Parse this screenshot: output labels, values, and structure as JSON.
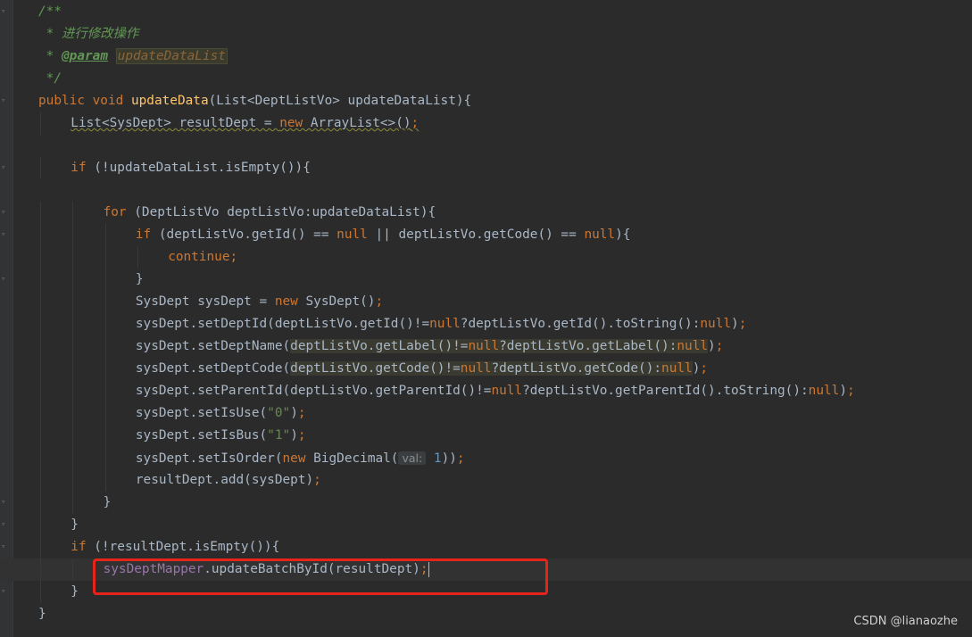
{
  "lines": [
    {
      "indent": 0,
      "tokens": [
        {
          "c": "doc",
          "t": "/**"
        }
      ]
    },
    {
      "indent": 0,
      "tokens": [
        {
          "c": "doc",
          "t": " * 进行修改操作"
        }
      ]
    },
    {
      "indent": 0,
      "tokens": [
        {
          "c": "doc",
          "t": " * "
        },
        {
          "c": "doctag",
          "t": "@param"
        },
        {
          "c": "doc",
          "t": " "
        },
        {
          "c": "docparam",
          "t": "updateDataList"
        }
      ]
    },
    {
      "indent": 0,
      "tokens": [
        {
          "c": "doc",
          "t": " */"
        }
      ]
    },
    {
      "indent": 0,
      "tokens": [
        {
          "c": "kw",
          "t": "public void "
        },
        {
          "c": "fn",
          "t": "updateData"
        },
        {
          "c": "",
          "t": "(List<DeptListVo> updateDataList){"
        }
      ]
    },
    {
      "indent": 1,
      "tokens": [
        {
          "c": "warn",
          "t": "List<SysDept> resultDept = "
        },
        {
          "c": "kw warn",
          "t": "new "
        },
        {
          "c": "warn",
          "t": "ArrayList<>()"
        },
        {
          "c": "kw warn",
          "t": ";"
        }
      ]
    },
    {
      "indent": 0,
      "tokens": []
    },
    {
      "indent": 1,
      "tokens": [
        {
          "c": "kw",
          "t": "if "
        },
        {
          "c": "",
          "t": "(!updateDataList.isEmpty()){"
        }
      ]
    },
    {
      "indent": 0,
      "tokens": []
    },
    {
      "indent": 2,
      "tokens": [
        {
          "c": "kw",
          "t": "for "
        },
        {
          "c": "",
          "t": "(DeptListVo deptListVo:updateDataList){"
        }
      ]
    },
    {
      "indent": 3,
      "tokens": [
        {
          "c": "kw",
          "t": "if "
        },
        {
          "c": "",
          "t": "(deptListVo.getId() == "
        },
        {
          "c": "kw",
          "t": "null "
        },
        {
          "c": "",
          "t": "|| deptListVo.getCode() == "
        },
        {
          "c": "kw",
          "t": "null"
        },
        {
          "c": "",
          "t": "){"
        }
      ]
    },
    {
      "indent": 4,
      "tokens": [
        {
          "c": "kw",
          "t": "continue;"
        }
      ]
    },
    {
      "indent": 3,
      "tokens": [
        {
          "c": "",
          "t": "}"
        }
      ]
    },
    {
      "indent": 3,
      "tokens": [
        {
          "c": "",
          "t": "SysDept sysDept = "
        },
        {
          "c": "kw",
          "t": "new "
        },
        {
          "c": "",
          "t": "SysDept()"
        },
        {
          "c": "kw",
          "t": ";"
        }
      ]
    },
    {
      "indent": 3,
      "tokens": [
        {
          "c": "",
          "t": "sysDept.setDeptId(deptListVo.getId()!="
        },
        {
          "c": "kw",
          "t": "null"
        },
        {
          "c": "",
          "t": "?deptListVo.getId().toString():"
        },
        {
          "c": "kw",
          "t": "null"
        },
        {
          "c": "",
          "t": ")"
        },
        {
          "c": "kw",
          "t": ";"
        }
      ]
    },
    {
      "indent": 3,
      "tokens": [
        {
          "c": "",
          "t": "sysDept.setDeptName("
        },
        {
          "c": "hl",
          "t": "deptListVo.getLabel()!="
        },
        {
          "c": "kw hl",
          "t": "null"
        },
        {
          "c": "hl",
          "t": "?deptListVo.getLabel():"
        },
        {
          "c": "kw hl",
          "t": "null"
        },
        {
          "c": "",
          "t": ")"
        },
        {
          "c": "kw",
          "t": ";"
        }
      ]
    },
    {
      "indent": 3,
      "tokens": [
        {
          "c": "",
          "t": "sysDept.setDeptCode("
        },
        {
          "c": "hl",
          "t": "deptListVo.getCode()!="
        },
        {
          "c": "kw hl",
          "t": "null"
        },
        {
          "c": "hl",
          "t": "?deptListVo.getCode():"
        },
        {
          "c": "kw hl",
          "t": "null"
        },
        {
          "c": "",
          "t": ")"
        },
        {
          "c": "kw",
          "t": ";"
        }
      ]
    },
    {
      "indent": 3,
      "tokens": [
        {
          "c": "",
          "t": "sysDept.setParentId(deptListVo.getParentId()!="
        },
        {
          "c": "kw",
          "t": "null"
        },
        {
          "c": "",
          "t": "?deptListVo.getParentId().toString():"
        },
        {
          "c": "kw",
          "t": "null"
        },
        {
          "c": "",
          "t": ")"
        },
        {
          "c": "kw",
          "t": ";"
        }
      ]
    },
    {
      "indent": 3,
      "tokens": [
        {
          "c": "",
          "t": "sysDept.setIsUse("
        },
        {
          "c": "str",
          "t": "\"0\""
        },
        {
          "c": "",
          "t": ")"
        },
        {
          "c": "kw",
          "t": ";"
        }
      ]
    },
    {
      "indent": 3,
      "tokens": [
        {
          "c": "",
          "t": "sysDept.setIsBus("
        },
        {
          "c": "str",
          "t": "\"1\""
        },
        {
          "c": "",
          "t": ")"
        },
        {
          "c": "kw",
          "t": ";"
        }
      ]
    },
    {
      "indent": 3,
      "tokens": [
        {
          "c": "",
          "t": "sysDept.setIsOrder("
        },
        {
          "c": "kw",
          "t": "new "
        },
        {
          "c": "",
          "t": "BigDecimal("
        },
        {
          "c": "hint",
          "t": "val:"
        },
        {
          "c": "num",
          "t": " 1"
        },
        {
          "c": "",
          "t": "))"
        },
        {
          "c": "kw",
          "t": ";"
        }
      ]
    },
    {
      "indent": 3,
      "tokens": [
        {
          "c": "",
          "t": "resultDept.add(sysDept)"
        },
        {
          "c": "kw",
          "t": ";"
        }
      ]
    },
    {
      "indent": 2,
      "tokens": [
        {
          "c": "",
          "t": "}"
        }
      ]
    },
    {
      "indent": 1,
      "tokens": [
        {
          "c": "",
          "t": "}"
        }
      ]
    },
    {
      "indent": 1,
      "tokens": [
        {
          "c": "kw",
          "t": "if "
        },
        {
          "c": "",
          "t": "(!resultDept.isEmpty()){"
        }
      ]
    },
    {
      "indent": 2,
      "current": true,
      "tokens": [
        {
          "c": "field",
          "t": "sysDeptMapper"
        },
        {
          "c": "",
          "t": ".updateBatchById(resultDept)"
        },
        {
          "c": "kw",
          "t": ";"
        },
        {
          "c": "caret",
          "t": ""
        }
      ]
    },
    {
      "indent": 1,
      "tokens": [
        {
          "c": "",
          "t": "}"
        }
      ]
    },
    {
      "indent": 0,
      "tokens": [
        {
          "c": "",
          "t": "}"
        }
      ]
    }
  ],
  "watermark": "CSDN @lianaozhe",
  "colors": {
    "background": "#2b2b2b",
    "keyword": "#cc7832",
    "method": "#ffc66d",
    "comment": "#629755",
    "string": "#6a8759",
    "field": "#9876aa",
    "number": "#6897bb",
    "highlight_box": "#e8231a"
  }
}
